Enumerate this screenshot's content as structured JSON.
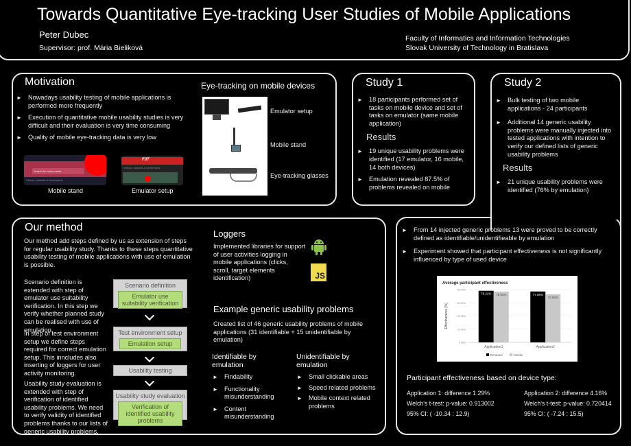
{
  "header": {
    "title": "Towards Quantitative Eye-tracking User Studies of Mobile Applications",
    "author": "Peter Dubec",
    "supervisor": "Supervisor: prof. Mária Bieliková",
    "faculty": "Faculty of Informatics and Information Technologies",
    "university": "Slovak University of Technology in Bratislava"
  },
  "motivation": {
    "title": "Motivation",
    "bullets": [
      "Nowadays usability testing of mobile applications is performed more frequently",
      "Execution of quantitative mobile usability studies is very difficult and their evaluation is very time consuming",
      "Quality of mobile eye-tracking data is very low"
    ],
    "images": [
      {
        "caption": "Mobile stand",
        "search_placeholder": "Search for video name",
        "tab_text": "Videos, tutorials & livestreams"
      },
      {
        "caption": "Emulator setup",
        "logo_text": "FIIT",
        "tab_text": "Videos, tutorials & livestreams"
      }
    ],
    "devices_title": "Eye-tracking on mobile devices",
    "devices": [
      "Emulator setup",
      "Mobile stand",
      "Eye-tracking glasses"
    ]
  },
  "study1": {
    "title": "Study 1",
    "bullets": [
      "18 participants performed set of tasks on mobile device and set of tasks on emulator (same mobile application)"
    ],
    "results_title": "Results",
    "results": [
      "19 unique usability problems were identified (17 emulator, 16 mobile, 14 both devices)",
      "Emulation revealed 87.5% of problems revealed on mobile"
    ]
  },
  "study2": {
    "title": "Study 2",
    "bullets": [
      "Bulk testing of two mobile applications - 24 participants",
      "Additional 14 generic usability problems were manually injected into tested applications with intention to verify our defined lists of generic usability problems"
    ],
    "results_title": "Results",
    "results": [
      "21 unique usability problems were identified (76% by emulation)",
      "From 14 injected generic problems 13 were proved to be correctly defined as identifiable/unidentifieable by emulation",
      "Experiment showed that participant effectiveness is not significantly influenced by type of used device"
    ],
    "effectiveness_title": "Participant effectiveness based on device type:",
    "app1": [
      "Application 1: difference 1.29%",
      "Welch's t-test: p-value: 0.913002",
      "95% CI: ( -10.34 : 12.9)"
    ],
    "app2": [
      "Application 2: difference 4.16%",
      "Welch's t-test: p-value: 0.720414",
      "95% CI: ( -7.24 : 15.5)"
    ]
  },
  "method": {
    "title": "Our method",
    "intro": "Our method  add steps defined by us as extension of steps for regular usability study. Thanks to these steps quantitative usability testing of mobile applications with use of emulation is possible.",
    "paragraphs": [
      "Scenario definition is extended with step of emulator use suitability verification. In this step we verify whether planned study can be realised with use of emulation.",
      "In step of test environment setup we define steps required for correct emulation setup. This inncludes also inserting of loggers for user activity monitoring.",
      "Usability study evaluation is extended with step of verification of identified usability problems. We need to verify validity of identified problems thanks to our lists of generic usability problems."
    ],
    "steps": [
      {
        "label": "Scenario definition",
        "sub": "Emulator use suitability verification"
      },
      {
        "label": "Test environment setup",
        "sub": "Emulation setup"
      },
      {
        "label": "Usability testing",
        "sub": null
      },
      {
        "label": "Usability study evaluation",
        "sub": "Verification of identified usability problems"
      }
    ]
  },
  "loggers": {
    "title": "Loggers",
    "text": "Implemented libraries for support of user activities logging in mobile applications (clicks, scroll, target elements identification)",
    "icons": [
      "android-icon",
      "javascript-icon"
    ],
    "js_label": "JS",
    "android_color": "#8bc34a",
    "js_color": "#f0db4f"
  },
  "problems": {
    "title": "Example generic usability problems",
    "text": "Created list of 46 generic usability problems of mobile applications (31 identifiable + 15 unidentifiable by emulation)",
    "identifiable_title": "Identifiable by emulation",
    "identifiable": [
      "Findability",
      "Functionality misunderstanding",
      "Content misunderstanding"
    ],
    "unidentifiable_title": "Unidentifiable by emulation",
    "unidentifiable": [
      "Small clickable areas",
      "Speed related problems",
      "Mobile context related problems"
    ]
  },
  "chart_data": {
    "type": "bar",
    "title": "Average participant effectiveness",
    "xlabel": "",
    "ylabel": "Effectiveness [%]",
    "categories": [
      "Application1",
      "Application2"
    ],
    "series": [
      {
        "name": "Emulator",
        "values": [
          78.21,
          77.08
        ],
        "color": "#000000"
      },
      {
        "name": "Mobile",
        "values": [
          76.92,
          72.92
        ],
        "color": "#c8c8c8"
      }
    ],
    "data_labels": [
      [
        "78.21%",
        "76.92%"
      ],
      [
        "77.08%",
        "72.92%"
      ]
    ],
    "yticks": [
      "0.00%",
      "20.00%",
      "40.00%",
      "60.00%",
      "80.00%"
    ],
    "ylim": [
      0,
      80
    ],
    "grid": true,
    "legend": "bottom"
  }
}
